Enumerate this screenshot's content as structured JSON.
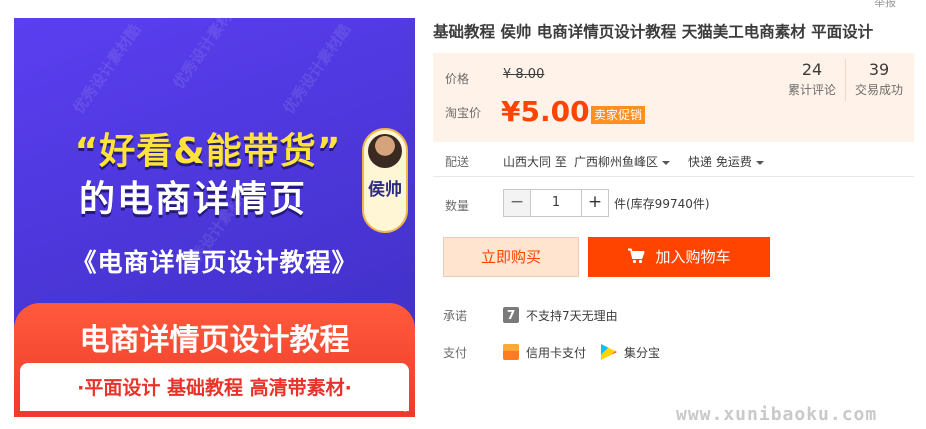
{
  "banner": {
    "headline_1": "“好看&能带货”",
    "headline_2": "的电商详情页",
    "subhead": "《电商详情页设计教程》",
    "red_title": "电商详情页设计教程",
    "bottom_line": "·平面设计 基础教程 高清带素材·",
    "author": "侯帅",
    "watermark": "优秀设计素材酷"
  },
  "top_mini": "举报",
  "product": {
    "title": "基础教程 侯帅 电商详情页设计教程 天猫美工电商素材 平面设计"
  },
  "price": {
    "price_label": "价格",
    "old_price": "¥ 8.00",
    "tb_label": "淘宝价",
    "new_price": "¥5.00",
    "promo": "卖家促销"
  },
  "stats": {
    "reviews_count": "24",
    "reviews_label": "累计评论",
    "sales_count": "39",
    "sales_label": "交易成功"
  },
  "shipping": {
    "label": "配送",
    "origin": "山西大同 至",
    "destination": "广西柳州鱼峰区",
    "method": "快递 免运费"
  },
  "quantity": {
    "label": "数量",
    "minus": "−",
    "value": "1",
    "plus": "+",
    "stock": "件(库存99740件)"
  },
  "actions": {
    "buy_now": "立即购买",
    "add_cart": "加入购物车"
  },
  "promise": {
    "label": "承诺",
    "icon_text": "7",
    "text": "不支持7天无理由"
  },
  "payment": {
    "label": "支付",
    "credit": "信用卡支付",
    "jifen": "集分宝"
  },
  "footer_watermark": "www.xunibaoku.com",
  "colors": {
    "accent": "#ff4400",
    "banner_purple": "#4a35d6",
    "headline_yellow": "#ffe23a",
    "price_bg": "#fff2e8"
  }
}
